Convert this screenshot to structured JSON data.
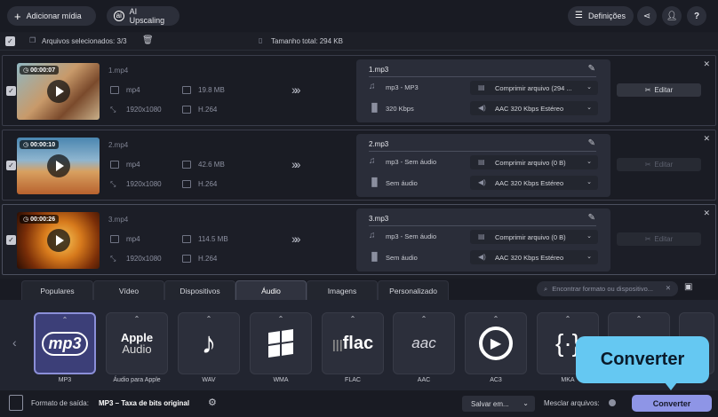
{
  "toolbar": {
    "add_media": "Adicionar mídia",
    "ai_upscaling": "AI Upscaling",
    "settings": "Definições"
  },
  "selection": {
    "selected": "Arquivos selecionados: 3/3",
    "total_size": "Tamanho total: 294 KB"
  },
  "files": [
    {
      "duration": "00:00:07",
      "name": "1.mp4",
      "container": "mp4",
      "size": "19.8 MB",
      "resolution": "1920x1080",
      "codec": "H.264",
      "output_name": "1.mp3",
      "output_format": "mp3 - MP3",
      "compress": "Comprimir arquivo (294 ...",
      "bitrate": "320 Kbps",
      "audio": "AAC 320 Kbps Estéreo",
      "edit": "Editar",
      "edit_enabled": true
    },
    {
      "duration": "00:00:10",
      "name": "2.mp4",
      "container": "mp4",
      "size": "42.6 MB",
      "resolution": "1920x1080",
      "codec": "H.264",
      "output_name": "2.mp3",
      "output_format": "mp3 - Sem áudio",
      "compress": "Comprimir arquivo (0 B)",
      "bitrate": "Sem áudio",
      "audio": "AAC 320 Kbps Estéreo",
      "edit": "Editar",
      "edit_enabled": false
    },
    {
      "duration": "00:00:26",
      "name": "3.mp4",
      "container": "mp4",
      "size": "114.5 MB",
      "resolution": "1920x1080",
      "codec": "H.264",
      "output_name": "3.mp3",
      "output_format": "mp3 - Sem áudio",
      "compress": "Comprimir arquivo (0 B)",
      "bitrate": "Sem áudio",
      "audio": "AAC 320 Kbps Estéreo",
      "edit": "Editar",
      "edit_enabled": false
    }
  ],
  "tabs": [
    "Populares",
    "Vídeo",
    "Dispositivos",
    "Áudio",
    "Imagens",
    "Personalizado"
  ],
  "active_tab": "Áudio",
  "search_placeholder": "Encontrar formato ou dispositivo...",
  "formats": [
    {
      "label": "MP3",
      "icon": "mp3"
    },
    {
      "label": "Áudio para Apple",
      "icon": "Apple Audio"
    },
    {
      "label": "WAV",
      "icon": "music-note-icon"
    },
    {
      "label": "WMA",
      "icon": "windows-icon"
    },
    {
      "label": "FLAC",
      "icon": "flac"
    },
    {
      "label": "AAC",
      "icon": "aac"
    },
    {
      "label": "AC3",
      "icon": "ac3-play-icon"
    },
    {
      "label": "MKA",
      "icon": "braces-icon"
    }
  ],
  "bottom": {
    "output_format_label": "Formato de saída:",
    "output_format_value": "MP3 – Taxa de bits original",
    "save_to": "Salvar em...",
    "merge": "Mesclar arquivos:",
    "convert": "Converter",
    "tooltip": "Converter"
  },
  "colors": {
    "accent": "#8e95e6",
    "tooltip": "#65c8f2"
  }
}
